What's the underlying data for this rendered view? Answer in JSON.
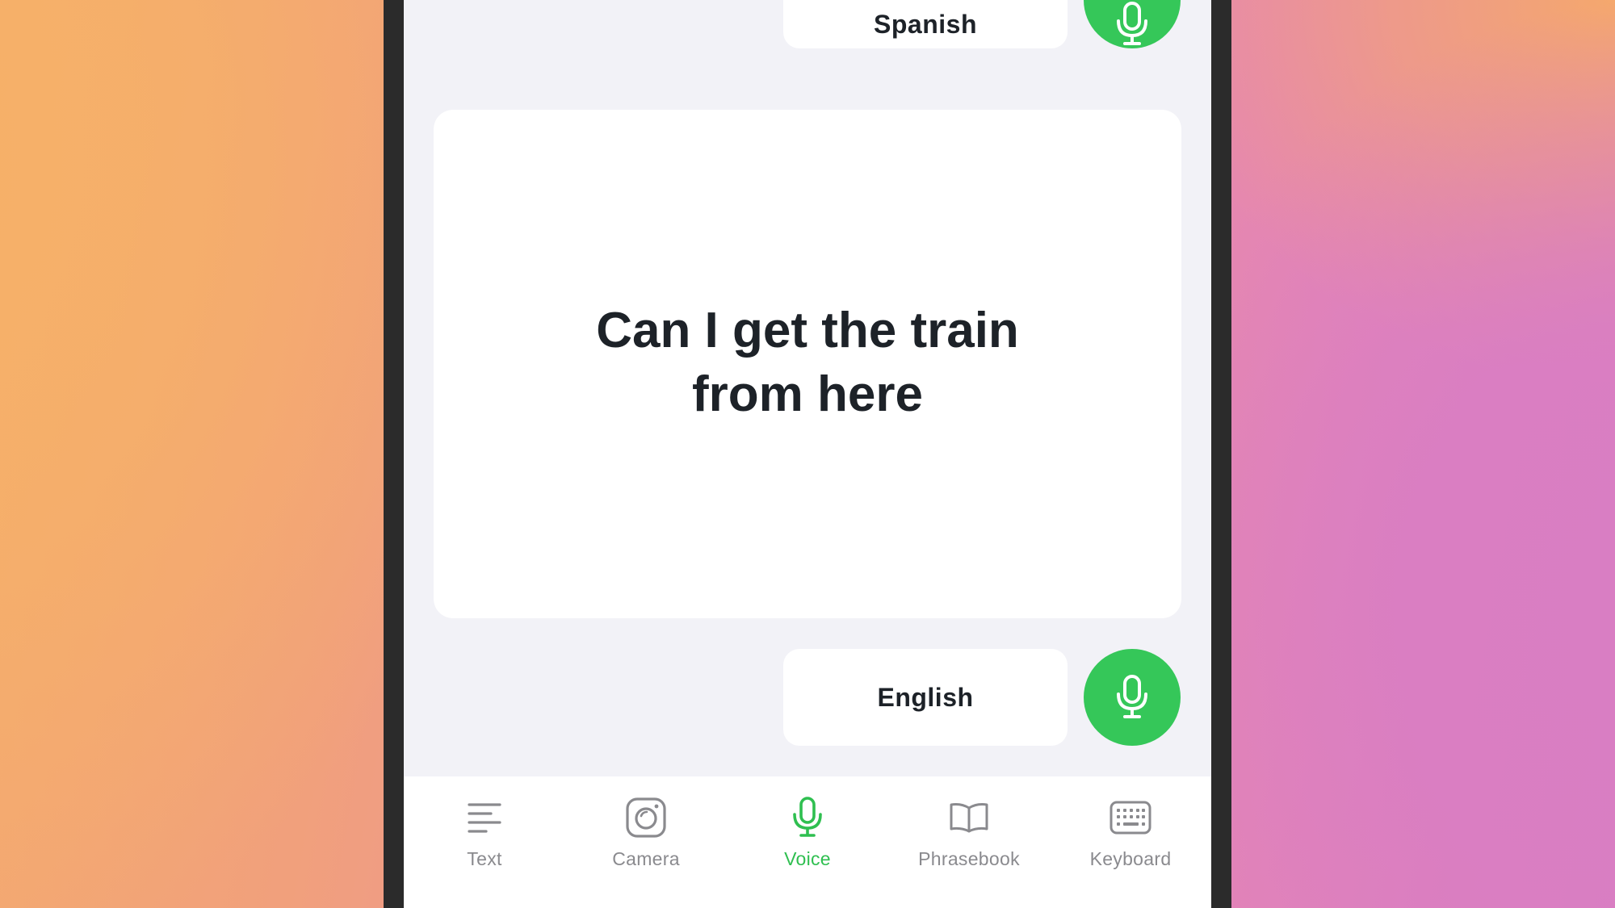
{
  "translator": {
    "source_language": "Spanish",
    "target_language": "English",
    "translated_text": "Can I get the train from here"
  },
  "tabs": [
    {
      "label": "Text",
      "icon": "text-lines-icon",
      "active": false
    },
    {
      "label": "Camera",
      "icon": "camera-icon",
      "active": false
    },
    {
      "label": "Voice",
      "icon": "microphone-icon",
      "active": true
    },
    {
      "label": "Phrasebook",
      "icon": "book-icon",
      "active": false
    },
    {
      "label": "Keyboard",
      "icon": "keyboard-icon",
      "active": false
    }
  ],
  "colors": {
    "accent_green": "#35c759",
    "active_tab_green": "#2fbf50",
    "inactive_gray": "#8a8a8e",
    "screen_background": "#f2f2f7"
  }
}
